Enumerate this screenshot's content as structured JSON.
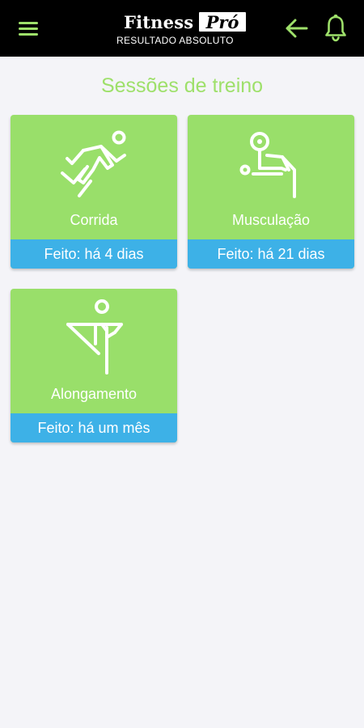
{
  "header": {
    "brand_word": "Fitness",
    "brand_badge": "Pró",
    "brand_tagline": "RESULTADO ABSOLUTO",
    "menu_icon": "menu-icon",
    "back_icon": "arrow-left-icon",
    "bell_icon": "bell-icon"
  },
  "colors": {
    "topbar": "#000000",
    "accent": "#9ee06a",
    "card": "#99df6a",
    "status": "#3db1e7",
    "background": "#f4f4f8"
  },
  "main": {
    "title": "Sessões de treino",
    "cards": [
      {
        "label": "Corrida",
        "status": "Feito: há 4 dias",
        "icon": "running-icon"
      },
      {
        "label": "Musculação",
        "status": "Feito: há 21 dias",
        "icon": "weightlifting-icon"
      },
      {
        "label": "Alongamento",
        "status": "Feito: há um mês",
        "icon": "stretching-icon"
      }
    ]
  }
}
